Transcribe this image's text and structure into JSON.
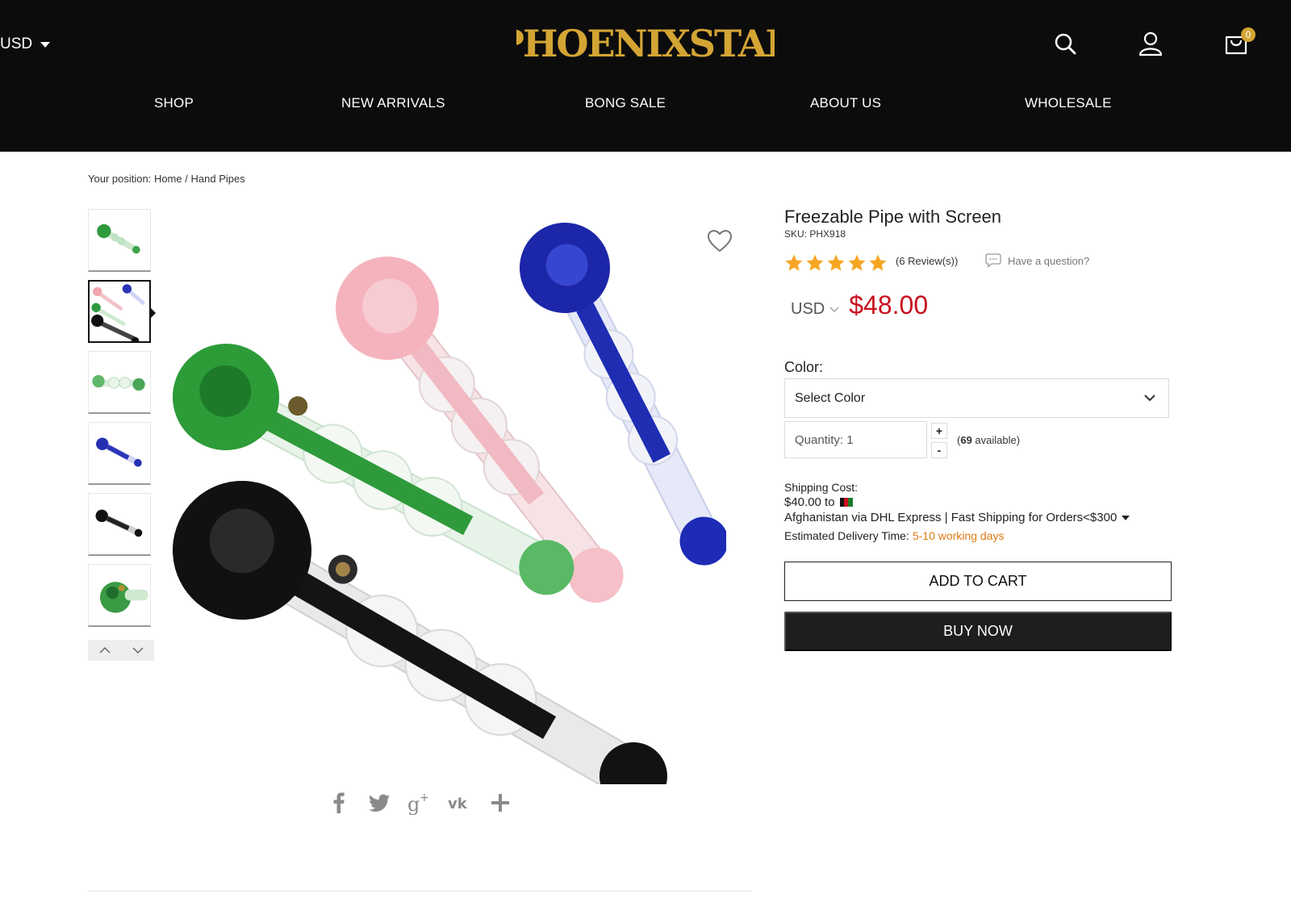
{
  "header": {
    "currency": "USD",
    "logo_text": "PHOENIXSTAR",
    "cart_count": "0",
    "nav": [
      "SHOP",
      "NEW ARRIVALS",
      "BONG SALE",
      "ABOUT US",
      "WHOLESALE"
    ]
  },
  "breadcrumb": {
    "prefix": "Your position:",
    "home": "Home",
    "separator": "/",
    "category": "Hand Pipes"
  },
  "gallery": {
    "active_thumbnail": 2,
    "thumbnail_count": 6
  },
  "product": {
    "title": "Freezable Pipe with Screen",
    "sku": "SKU: PHX918",
    "rating": 5,
    "reviews": "(6 Review(s))",
    "question_link": "Have a question?",
    "currency": "USD",
    "price": "$48.00",
    "color_label": "Color:",
    "color_placeholder": "Select Color",
    "quantity_label": "Quantity: 1",
    "qty_plus": "+",
    "qty_minus": "-",
    "available_prefix": "(",
    "available_count": "69",
    "available_suffix": " available)",
    "shipping_label": "Shipping Cost:",
    "shipping_price": "$40.00 to",
    "shipping_method": "Afghanistan via DHL Express | Fast Shipping for Orders<$300",
    "delivery_label": "Estimated Delivery Time:",
    "delivery_days": "5-10 working days",
    "add_to_cart": "ADD TO CART",
    "buy_now": "BUY NOW"
  },
  "colors": {
    "header_bg": "#0c0c0c",
    "logo_gold": "#d4a534",
    "price_red": "#c8101e",
    "delivery_orange": "#e07b14",
    "buy_now_bg": "#1e1e1e"
  }
}
